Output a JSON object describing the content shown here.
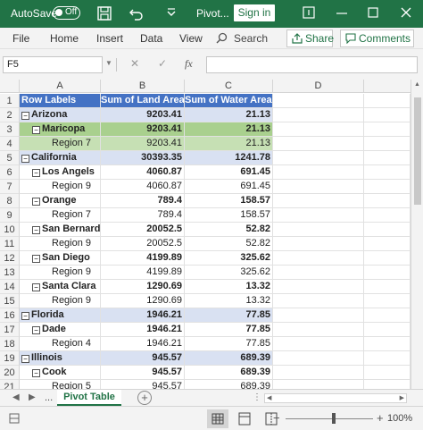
{
  "titlebar": {
    "autosave_label": "AutoSave",
    "autosave_state": "Off",
    "doc_title": "Pivot...",
    "signin_label": "Sign in"
  },
  "menu": {
    "items": [
      "File",
      "Home",
      "Insert",
      "Data",
      "View"
    ],
    "search_label": "Search",
    "share_label": "Share",
    "comments_label": "Comments"
  },
  "formula": {
    "namebox": "F5",
    "fx_label": "fx",
    "value": ""
  },
  "grid": {
    "columns": [
      "A",
      "B",
      "C",
      "D"
    ],
    "header": {
      "a": "Row Labels",
      "b": "Sum of Land Area",
      "c": "Sum of Water Area"
    },
    "rows": [
      {
        "n": "1",
        "a": "Row Labels",
        "b": "Sum of Land Area",
        "c": "Sum of Water Area"
      },
      {
        "n": "2",
        "a": "Arizona",
        "b": "9203.41",
        "c": "21.13"
      },
      {
        "n": "3",
        "a": "Maricopa",
        "b": "9203.41",
        "c": "21.13"
      },
      {
        "n": "4",
        "a": "Region 7",
        "b": "9203.41",
        "c": "21.13"
      },
      {
        "n": "5",
        "a": "California",
        "b": "30393.35",
        "c": "1241.78"
      },
      {
        "n": "6",
        "a": "Los Angels",
        "b": "4060.87",
        "c": "691.45"
      },
      {
        "n": "7",
        "a": "Region 9",
        "b": "4060.87",
        "c": "691.45"
      },
      {
        "n": "8",
        "a": "Orange",
        "b": "789.4",
        "c": "158.57"
      },
      {
        "n": "9",
        "a": "Region 7",
        "b": "789.4",
        "c": "158.57"
      },
      {
        "n": "10",
        "a": "San Bernard",
        "b": "20052.5",
        "c": "52.82"
      },
      {
        "n": "11",
        "a": "Region 9",
        "b": "20052.5",
        "c": "52.82"
      },
      {
        "n": "12",
        "a": "San Diego",
        "b": "4199.89",
        "c": "325.62"
      },
      {
        "n": "13",
        "a": "Region 9",
        "b": "4199.89",
        "c": "325.62"
      },
      {
        "n": "14",
        "a": "Santa Clara",
        "b": "1290.69",
        "c": "13.32"
      },
      {
        "n": "15",
        "a": "Region 9",
        "b": "1290.69",
        "c": "13.32"
      },
      {
        "n": "16",
        "a": "Florida",
        "b": "1946.21",
        "c": "77.85"
      },
      {
        "n": "17",
        "a": "Dade",
        "b": "1946.21",
        "c": "77.85"
      },
      {
        "n": "18",
        "a": "Region 4",
        "b": "1946.21",
        "c": "77.85"
      },
      {
        "n": "19",
        "a": "Illinois",
        "b": "945.57",
        "c": "689.39"
      },
      {
        "n": "20",
        "a": "Cook",
        "b": "945.57",
        "c": "689.39"
      },
      {
        "n": "21",
        "a": "Region 5",
        "b": "945.57",
        "c": "689.39"
      }
    ]
  },
  "tabs": {
    "ellipsis": "...",
    "sheet_name": "Pivot Table",
    "add_symbol": "+"
  },
  "status": {
    "zoom": "100%"
  },
  "colors": {
    "brand": "#217346",
    "header_fill": "#4472c4",
    "level1_fill": "#d9e1f2",
    "selection_fill": "#a9d08e"
  }
}
